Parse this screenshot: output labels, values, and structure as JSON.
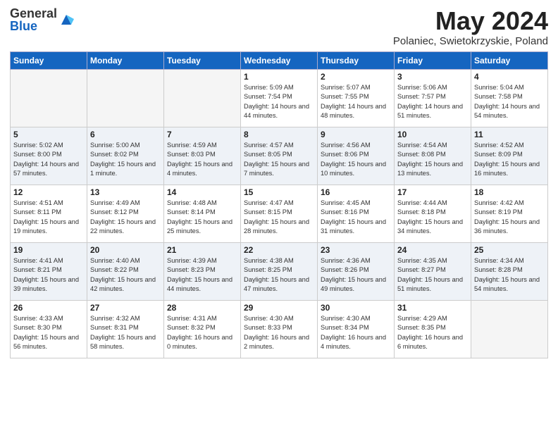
{
  "header": {
    "logo_general": "General",
    "logo_blue": "Blue",
    "month_title": "May 2024",
    "location": "Polaniec, Swietokrzyskie, Poland"
  },
  "days_of_week": [
    "Sunday",
    "Monday",
    "Tuesday",
    "Wednesday",
    "Thursday",
    "Friday",
    "Saturday"
  ],
  "weeks": [
    [
      {
        "day": "",
        "empty": true
      },
      {
        "day": "",
        "empty": true
      },
      {
        "day": "",
        "empty": true
      },
      {
        "day": "1",
        "sunrise": "5:09 AM",
        "sunset": "7:54 PM",
        "daylight": "14 hours and 44 minutes."
      },
      {
        "day": "2",
        "sunrise": "5:07 AM",
        "sunset": "7:55 PM",
        "daylight": "14 hours and 48 minutes."
      },
      {
        "day": "3",
        "sunrise": "5:06 AM",
        "sunset": "7:57 PM",
        "daylight": "14 hours and 51 minutes."
      },
      {
        "day": "4",
        "sunrise": "5:04 AM",
        "sunset": "7:58 PM",
        "daylight": "14 hours and 54 minutes."
      }
    ],
    [
      {
        "day": "5",
        "sunrise": "5:02 AM",
        "sunset": "8:00 PM",
        "daylight": "14 hours and 57 minutes."
      },
      {
        "day": "6",
        "sunrise": "5:00 AM",
        "sunset": "8:02 PM",
        "daylight": "15 hours and 1 minute."
      },
      {
        "day": "7",
        "sunrise": "4:59 AM",
        "sunset": "8:03 PM",
        "daylight": "15 hours and 4 minutes."
      },
      {
        "day": "8",
        "sunrise": "4:57 AM",
        "sunset": "8:05 PM",
        "daylight": "15 hours and 7 minutes."
      },
      {
        "day": "9",
        "sunrise": "4:56 AM",
        "sunset": "8:06 PM",
        "daylight": "15 hours and 10 minutes."
      },
      {
        "day": "10",
        "sunrise": "4:54 AM",
        "sunset": "8:08 PM",
        "daylight": "15 hours and 13 minutes."
      },
      {
        "day": "11",
        "sunrise": "4:52 AM",
        "sunset": "8:09 PM",
        "daylight": "15 hours and 16 minutes."
      }
    ],
    [
      {
        "day": "12",
        "sunrise": "4:51 AM",
        "sunset": "8:11 PM",
        "daylight": "15 hours and 19 minutes."
      },
      {
        "day": "13",
        "sunrise": "4:49 AM",
        "sunset": "8:12 PM",
        "daylight": "15 hours and 22 minutes."
      },
      {
        "day": "14",
        "sunrise": "4:48 AM",
        "sunset": "8:14 PM",
        "daylight": "15 hours and 25 minutes."
      },
      {
        "day": "15",
        "sunrise": "4:47 AM",
        "sunset": "8:15 PM",
        "daylight": "15 hours and 28 minutes."
      },
      {
        "day": "16",
        "sunrise": "4:45 AM",
        "sunset": "8:16 PM",
        "daylight": "15 hours and 31 minutes."
      },
      {
        "day": "17",
        "sunrise": "4:44 AM",
        "sunset": "8:18 PM",
        "daylight": "15 hours and 34 minutes."
      },
      {
        "day": "18",
        "sunrise": "4:42 AM",
        "sunset": "8:19 PM",
        "daylight": "15 hours and 36 minutes."
      }
    ],
    [
      {
        "day": "19",
        "sunrise": "4:41 AM",
        "sunset": "8:21 PM",
        "daylight": "15 hours and 39 minutes."
      },
      {
        "day": "20",
        "sunrise": "4:40 AM",
        "sunset": "8:22 PM",
        "daylight": "15 hours and 42 minutes."
      },
      {
        "day": "21",
        "sunrise": "4:39 AM",
        "sunset": "8:23 PM",
        "daylight": "15 hours and 44 minutes."
      },
      {
        "day": "22",
        "sunrise": "4:38 AM",
        "sunset": "8:25 PM",
        "daylight": "15 hours and 47 minutes."
      },
      {
        "day": "23",
        "sunrise": "4:36 AM",
        "sunset": "8:26 PM",
        "daylight": "15 hours and 49 minutes."
      },
      {
        "day": "24",
        "sunrise": "4:35 AM",
        "sunset": "8:27 PM",
        "daylight": "15 hours and 51 minutes."
      },
      {
        "day": "25",
        "sunrise": "4:34 AM",
        "sunset": "8:28 PM",
        "daylight": "15 hours and 54 minutes."
      }
    ],
    [
      {
        "day": "26",
        "sunrise": "4:33 AM",
        "sunset": "8:30 PM",
        "daylight": "15 hours and 56 minutes."
      },
      {
        "day": "27",
        "sunrise": "4:32 AM",
        "sunset": "8:31 PM",
        "daylight": "15 hours and 58 minutes."
      },
      {
        "day": "28",
        "sunrise": "4:31 AM",
        "sunset": "8:32 PM",
        "daylight": "16 hours and 0 minutes."
      },
      {
        "day": "29",
        "sunrise": "4:30 AM",
        "sunset": "8:33 PM",
        "daylight": "16 hours and 2 minutes."
      },
      {
        "day": "30",
        "sunrise": "4:30 AM",
        "sunset": "8:34 PM",
        "daylight": "16 hours and 4 minutes."
      },
      {
        "day": "31",
        "sunrise": "4:29 AM",
        "sunset": "8:35 PM",
        "daylight": "16 hours and 6 minutes."
      },
      {
        "day": "",
        "empty": true
      }
    ]
  ],
  "labels": {
    "sunrise": "Sunrise:",
    "sunset": "Sunset:",
    "daylight": "Daylight:"
  }
}
